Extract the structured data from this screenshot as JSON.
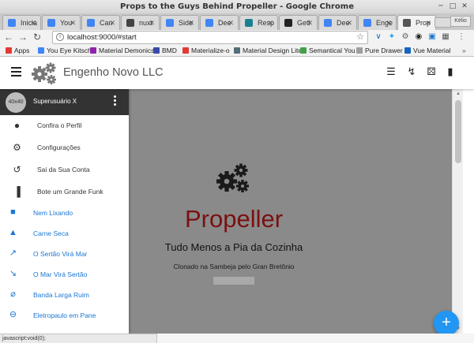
{
  "window": {
    "title": "Props to the Guys Behind Propeller - Google Chrome"
  },
  "tabs": [
    {
      "label": "Inicia",
      "color": "#4285f4"
    },
    {
      "label": "You",
      "color": "#4285f4"
    },
    {
      "label": "Can",
      "color": "#4285f4"
    },
    {
      "label": "nuxt",
      "color": "#444444"
    },
    {
      "label": "Side",
      "color": "#4285f4"
    },
    {
      "label": "Dee",
      "color": "#4285f4"
    },
    {
      "label": "Resp",
      "color": "#1a7f8e"
    },
    {
      "label": "Getl",
      "color": "#222222"
    },
    {
      "label": "Dee",
      "color": "#4285f4"
    },
    {
      "label": "Enge",
      "color": "#4285f4"
    },
    {
      "label": "Prop",
      "color": "#555555"
    }
  ],
  "profile_chip": "Kélio",
  "address_bar": {
    "url": "localhost:9000/#start"
  },
  "bookmarks": [
    {
      "label": "Apps",
      "color": "#e53935"
    },
    {
      "label": "You Eye Kitsch",
      "color": "#4285f4"
    },
    {
      "label": "Material Demonics",
      "color": "#8e24aa"
    },
    {
      "label": "BMD",
      "color": "#3949ab"
    },
    {
      "label": "Materialize-o",
      "color": "#e53935"
    },
    {
      "label": "Material Design Lite",
      "color": "#546e7a"
    },
    {
      "label": "Semantical You",
      "color": "#43a047"
    },
    {
      "label": "Pure Drawer",
      "color": "#9e9e9e"
    },
    {
      "label": "Vue Material",
      "color": "#1565c0"
    }
  ],
  "app_header": {
    "brand": "Engenho Novo LLC"
  },
  "sidebar": {
    "avatar_text": "40x40",
    "user_name": "Superusuário X",
    "menu_items": [
      {
        "label": "Confira o Perfil",
        "icon": "person-icon"
      },
      {
        "label": "Configurações",
        "icon": "settings-icon"
      },
      {
        "label": "Sai da Sua Conta",
        "icon": "history-icon"
      },
      {
        "label": "Bote um Grande Funk",
        "icon": "bar-chart-icon"
      }
    ],
    "nav_items": [
      {
        "label": "Nem Lixando",
        "icon": "trash-icon"
      },
      {
        "label": "Carne Seca",
        "icon": "bell-icon"
      },
      {
        "label": "O Sertão Virá Mar",
        "icon": "trending-up-icon"
      },
      {
        "label": "O Mar Virá Sertão",
        "icon": "trending-down-icon"
      },
      {
        "label": "Banda Larga Ruim",
        "icon": "mic-off-icon"
      },
      {
        "label": "Eletropaulo em Pane",
        "icon": "zoom-out-icon"
      }
    ]
  },
  "hero": {
    "title": "Propeller",
    "subtitle": "Tudo Menos a Pia da Cozinha",
    "caption": "Clonado na Sambeja pelo Gran Bretônio"
  },
  "status_bar": {
    "text": "javascript:void(0);"
  },
  "colors": {
    "accent": "#2196f3",
    "hero_title": "#7b1010",
    "overlay": "#8a8a8a",
    "link": "#1976d2"
  }
}
